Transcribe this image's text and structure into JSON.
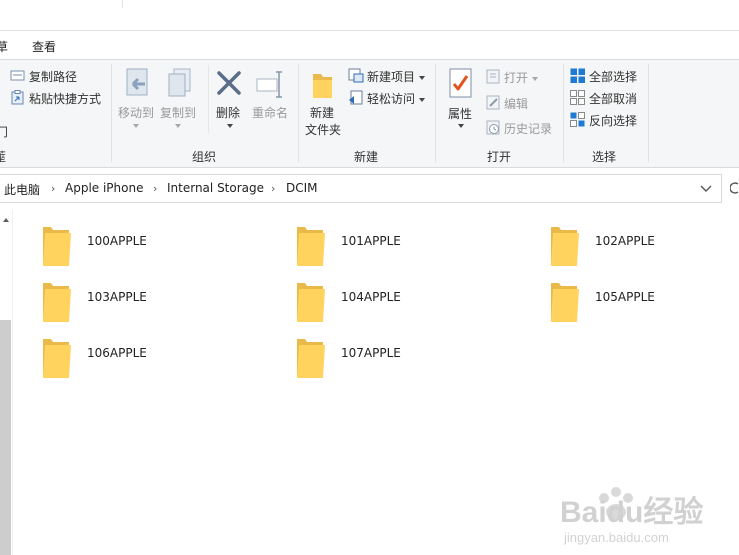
{
  "ribbon_tabs": {
    "partial": "草",
    "view": "查看"
  },
  "clipboard": {
    "copy_path": "复制路径",
    "paste_shortcut": "粘贴快捷方式",
    "partial_a": "冂",
    "partial_b": "蓙"
  },
  "organize": {
    "move_to": "移动到",
    "copy_to": "复制到",
    "delete": "删除",
    "rename": "重命名",
    "label": "组织"
  },
  "new_group": {
    "new_folder_line1": "新建",
    "new_folder_line2": "文件夹",
    "new_item": "新建项目",
    "easy_access": "轻松访问",
    "label": "新建"
  },
  "open_group": {
    "properties": "属性",
    "open": "打开",
    "edit": "编辑",
    "history": "历史记录",
    "label": "打开"
  },
  "select_group": {
    "select_all": "全部选择",
    "select_none": "全部取消",
    "invert": "反向选择",
    "label": "选择"
  },
  "address": {
    "crumbs": [
      "此电脑",
      "Apple iPhone",
      "Internal Storage",
      "DCIM"
    ]
  },
  "folders": [
    "100APPLE",
    "101APPLE",
    "102APPLE",
    "103APPLE",
    "104APPLE",
    "105APPLE",
    "106APPLE",
    "107APPLE"
  ],
  "colors": {
    "folder_back": "#e9b949",
    "folder_front": "#ffd35e",
    "accent_blue": "#1e7ad2"
  },
  "watermark": {
    "brand": "Baidu经验",
    "url": "jingyan.baidu.com"
  }
}
